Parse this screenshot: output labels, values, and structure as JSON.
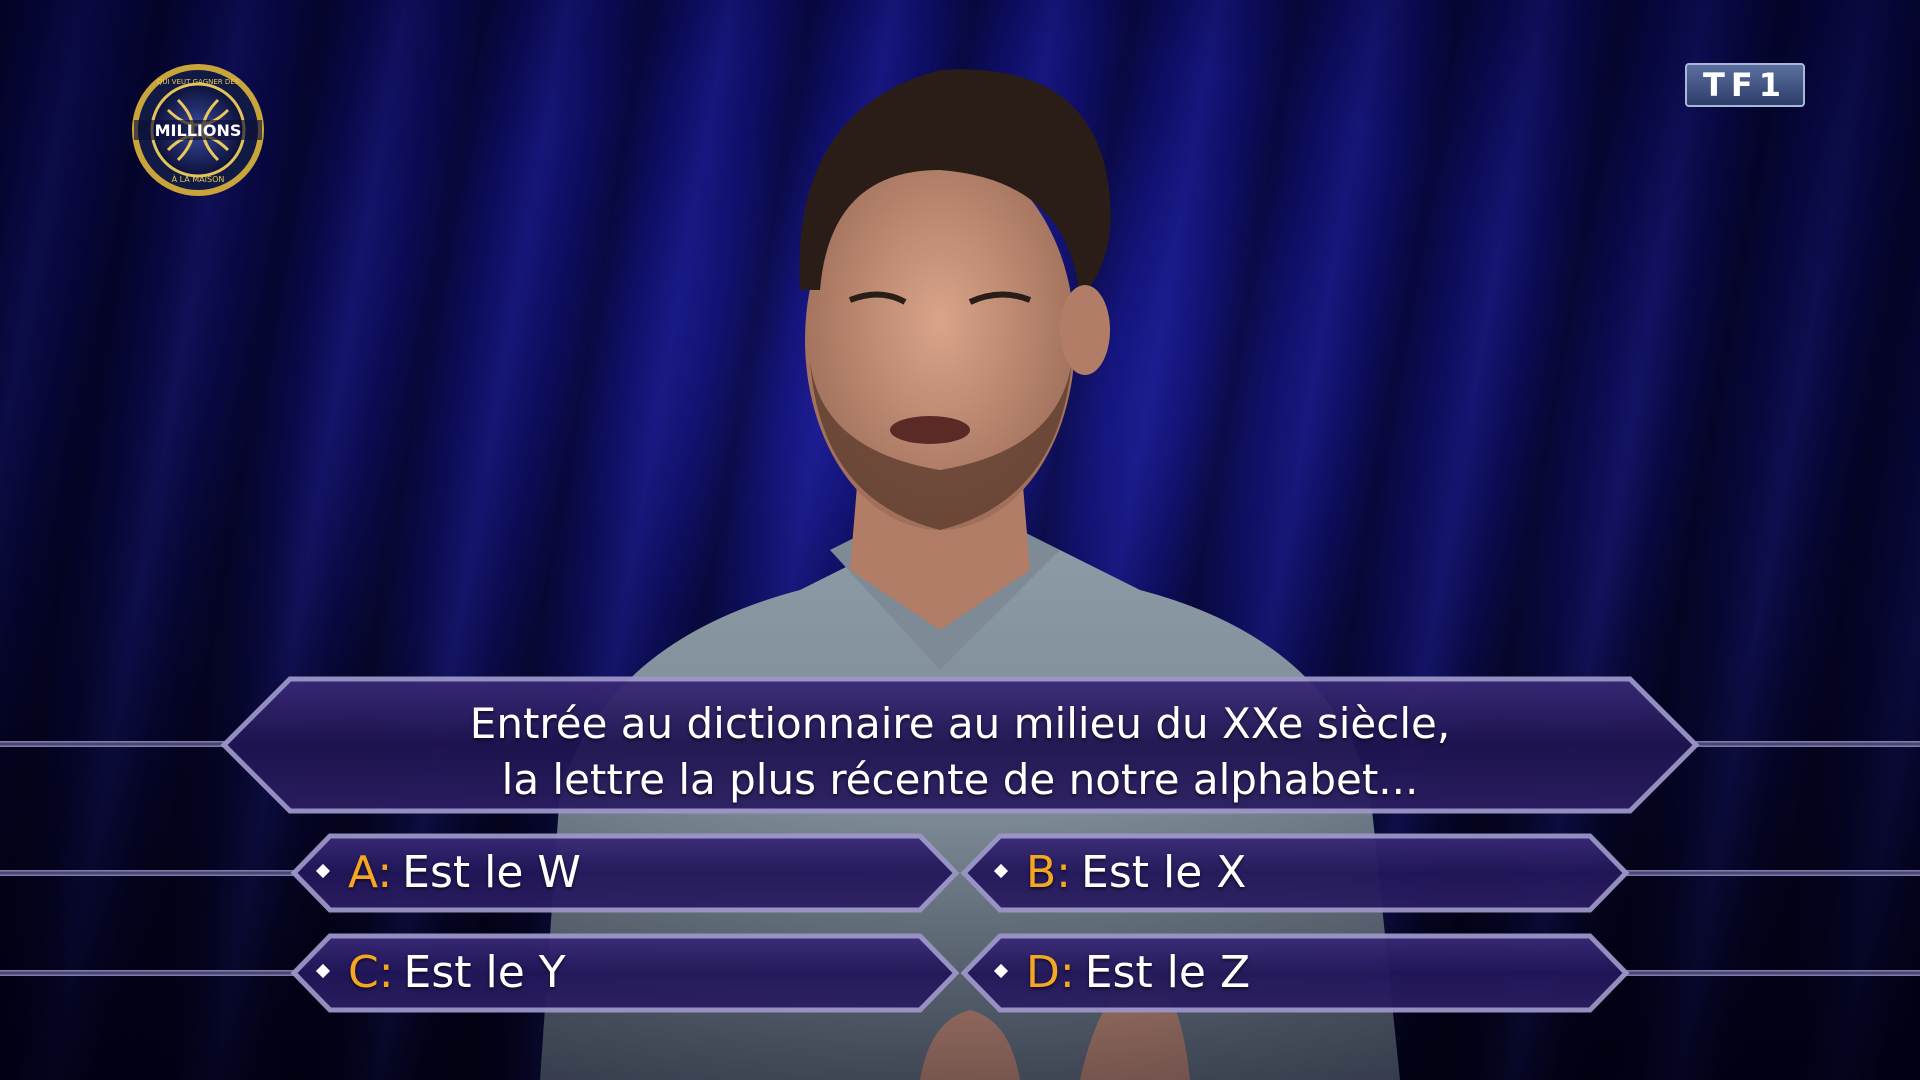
{
  "show_logo": {
    "top_text": "QUI VEUT GAGNER DES",
    "main_text": "MILLIONS",
    "bottom_text": "À LA MAISON"
  },
  "channel_logo": {
    "text": "TF1"
  },
  "question": {
    "line1": "Entrée au dictionnaire au milieu du XXe siècle,",
    "line2": "la lettre la plus récente de notre alphabet..."
  },
  "answers": [
    {
      "letter": "A:",
      "text": "Est le W"
    },
    {
      "letter": "B:",
      "text": "Est le X"
    },
    {
      "letter": "C:",
      "text": "Est le Y"
    },
    {
      "letter": "D:",
      "text": "Est le Z"
    }
  ],
  "colors": {
    "answer_letter": "#f5a623",
    "panel_fill": "#2a1a5e",
    "panel_border": "#9c95c8",
    "background": "#0a0a55"
  }
}
